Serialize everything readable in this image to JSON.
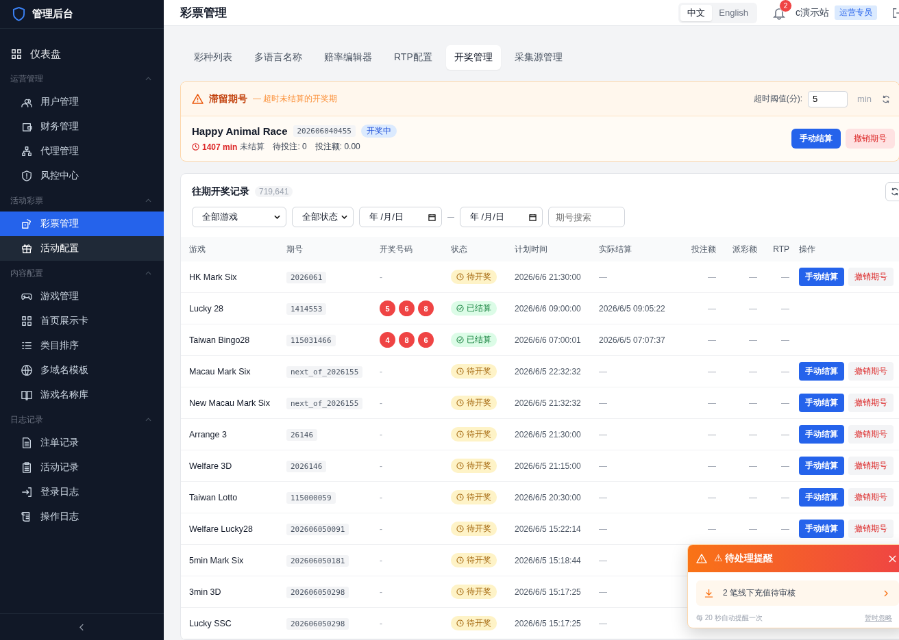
{
  "app": {
    "title": "管理后台"
  },
  "sidebar": {
    "dashboard": {
      "label": "仪表盘",
      "selected": false
    },
    "groups": [
      {
        "title": "运营管理",
        "expanded": true,
        "items": [
          {
            "label": "用户管理",
            "selected": false,
            "highlighted": false
          },
          {
            "label": "财务管理",
            "selected": false,
            "highlighted": false
          },
          {
            "label": "代理管理",
            "selected": false,
            "highlighted": false
          },
          {
            "label": "风控中心",
            "selected": false,
            "highlighted": false
          }
        ]
      },
      {
        "title": "活动彩票",
        "expanded": true,
        "items": [
          {
            "label": "彩票管理",
            "selected": true,
            "highlighted": false
          },
          {
            "label": "活动配置",
            "selected": false,
            "highlighted": true
          }
        ]
      },
      {
        "title": "内容配置",
        "expanded": true,
        "items": [
          {
            "label": "游戏管理",
            "selected": false,
            "highlighted": false
          },
          {
            "label": "首页展示卡",
            "selected": false,
            "highlighted": false
          },
          {
            "label": "类目排序",
            "selected": false,
            "highlighted": false
          },
          {
            "label": "多域名模板",
            "selected": false,
            "highlighted": false
          },
          {
            "label": "游戏名称库",
            "selected": false,
            "highlighted": false
          }
        ]
      },
      {
        "title": "日志记录",
        "expanded": true,
        "items": [
          {
            "label": "注单记录",
            "selected": false,
            "highlighted": false
          },
          {
            "label": "活动记录",
            "selected": false,
            "highlighted": false
          },
          {
            "label": "登录日志",
            "selected": false,
            "highlighted": false
          },
          {
            "label": "操作日志",
            "selected": false,
            "highlighted": false
          }
        ]
      }
    ]
  },
  "header": {
    "title": "彩票管理",
    "languages": [
      {
        "label": "中文",
        "selected": true
      },
      {
        "label": "English",
        "selected": false
      }
    ],
    "notifications": "2",
    "site": "c演示站",
    "role": "运营专员"
  },
  "tabs": [
    {
      "label": "彩种列表",
      "selected": false
    },
    {
      "label": "多语言名称",
      "selected": false
    },
    {
      "label": "赔率编辑器",
      "selected": false
    },
    {
      "label": "RTP配置",
      "selected": false
    },
    {
      "label": "开奖管理",
      "selected": true
    },
    {
      "label": "采集源管理",
      "selected": false
    }
  ],
  "stuck": {
    "title": "滞留期号",
    "subtitle": "— 超时未结算的开奖期",
    "threshold_label": "超时阈值(分):",
    "threshold": "5",
    "unit": "min",
    "item": {
      "game": "Happy Animal Race",
      "issue": "202606040455",
      "status": "开奖中",
      "overdue": "1407 min",
      "overdue_note": "未结算",
      "pending_bets": "待投注: 0",
      "bet_amount": "投注额: 0.00",
      "actions": [
        "手动结算",
        "撤销期号"
      ]
    }
  },
  "history": {
    "title": "往期开奖记录",
    "count": "719,641",
    "filters": {
      "game": "全部游戏",
      "status": "全部状态",
      "date_from": "年 /月/日",
      "date_to": "年 /月/日",
      "issue_placeholder": "期号搜索"
    },
    "columns": [
      "游戏",
      "期号",
      "开奖号码",
      "状态",
      "计划时间",
      "实际结算",
      "投注额",
      "派彩额",
      "RTP",
      "操作"
    ],
    "rows": [
      {
        "game": "HK Mark Six",
        "issue": "2026061",
        "draw": "-",
        "status": "待开奖",
        "kind": "pending",
        "planned": "2026/6/6 21:30:00",
        "actual": "—",
        "bet": "—",
        "payout": "—",
        "rtp": "—",
        "actions": [
          "手动结算",
          "撤销期号"
        ]
      },
      {
        "game": "Lucky 28",
        "issue": "1414553",
        "balls": [
          "5",
          "6",
          "8"
        ],
        "status": "已结算",
        "kind": "settled",
        "planned": "2026/6/6 09:00:00",
        "actual": "2026/6/5 09:05:22",
        "bet": "—",
        "payout": "—",
        "rtp": "—"
      },
      {
        "game": "Taiwan Bingo28",
        "issue": "115031466",
        "balls": [
          "4",
          "8",
          "6"
        ],
        "status": "已结算",
        "kind": "settled",
        "planned": "2026/6/6 07:00:01",
        "actual": "2026/6/5 07:07:37",
        "bet": "—",
        "payout": "—",
        "rtp": "—"
      },
      {
        "game": "Macau Mark Six",
        "issue": "next_of_2026155",
        "draw": "-",
        "status": "待开奖",
        "kind": "pending",
        "planned": "2026/6/5 22:32:32",
        "actual": "—",
        "bet": "—",
        "payout": "—",
        "rtp": "—",
        "actions": [
          "手动结算",
          "撤销期号"
        ]
      },
      {
        "game": "New Macau Mark Six",
        "issue": "next_of_2026155",
        "draw": "-",
        "status": "待开奖",
        "kind": "pending",
        "planned": "2026/6/5 21:32:32",
        "actual": "—",
        "bet": "—",
        "payout": "—",
        "rtp": "—",
        "actions": [
          "手动结算",
          "撤销期号"
        ]
      },
      {
        "game": "Arrange 3",
        "issue": "26146",
        "draw": "-",
        "status": "待开奖",
        "kind": "pending",
        "planned": "2026/6/5 21:30:00",
        "actual": "—",
        "bet": "—",
        "payout": "—",
        "rtp": "—",
        "actions": [
          "手动结算",
          "撤销期号"
        ]
      },
      {
        "game": "Welfare 3D",
        "issue": "2026146",
        "draw": "-",
        "status": "待开奖",
        "kind": "pending",
        "planned": "2026/6/5 21:15:00",
        "actual": "—",
        "bet": "—",
        "payout": "—",
        "rtp": "—",
        "actions": [
          "手动结算",
          "撤销期号"
        ]
      },
      {
        "game": "Taiwan Lotto",
        "issue": "115000059",
        "draw": "-",
        "status": "待开奖",
        "kind": "pending",
        "planned": "2026/6/5 20:30:00",
        "actual": "—",
        "bet": "—",
        "payout": "—",
        "rtp": "—",
        "actions": [
          "手动结算",
          "撤销期号"
        ]
      },
      {
        "game": "Welfare Lucky28",
        "issue": "202606050091",
        "draw": "-",
        "status": "待开奖",
        "kind": "pending",
        "planned": "2026/6/5 15:22:14",
        "actual": "—",
        "bet": "—",
        "payout": "—",
        "rtp": "—",
        "actions": [
          "手动结算",
          "撤销期号"
        ]
      },
      {
        "game": "5min Mark Six",
        "issue": "202606050181",
        "draw": "-",
        "status": "待开奖",
        "kind": "pending",
        "planned": "2026/6/5 15:18:44",
        "actual": "—"
      },
      {
        "game": "3min 3D",
        "issue": "202606050298",
        "draw": "-",
        "status": "待开奖",
        "kind": "pending",
        "planned": "2026/6/5 15:17:25",
        "actual": "—"
      },
      {
        "game": "Lucky SSC",
        "issue": "202606050298",
        "draw": "-",
        "status": "待开奖",
        "kind": "pending",
        "planned": "2026/6/5 15:17:25",
        "actual": "—"
      }
    ]
  },
  "reminder": {
    "title": "⚠ 待处理提醒",
    "items": [
      "2 笔线下充值待审核"
    ],
    "footer": "每 20 秒自动提醒一次",
    "dismiss": "暂时忽略"
  }
}
